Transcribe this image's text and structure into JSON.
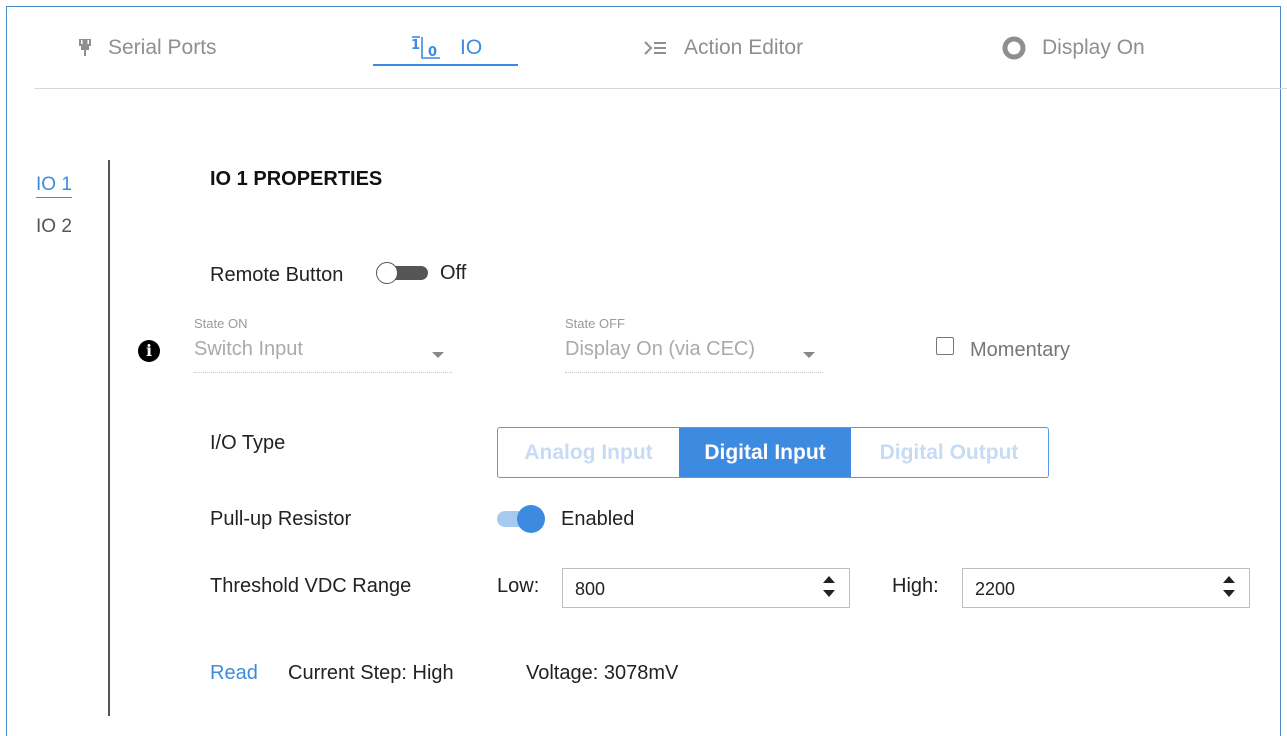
{
  "tabs": [
    {
      "label": "Serial Ports",
      "icon": "serial-port-icon",
      "active": false
    },
    {
      "label": "IO",
      "icon": "io-icon",
      "active": true
    },
    {
      "label": "Action Editor",
      "icon": "action-editor-icon",
      "active": false
    },
    {
      "label": "Display On",
      "icon": "display-on-icon",
      "active": false
    }
  ],
  "sidebar": {
    "items": [
      {
        "label": "IO 1",
        "active": true
      },
      {
        "label": "IO 2",
        "active": false
      }
    ]
  },
  "panel": {
    "title": "IO 1 PROPERTIES",
    "remote_button": {
      "label": "Remote Button",
      "state": "Off"
    },
    "state_on": {
      "caption": "State ON",
      "value": "Switch Input"
    },
    "state_off": {
      "caption": "State OFF",
      "value": "Display On (via CEC)"
    },
    "momentary": {
      "label": "Momentary",
      "checked": false
    },
    "io_type": {
      "label": "I/O Type",
      "options": [
        "Analog Input",
        "Digital Input",
        "Digital Output"
      ],
      "selected": "Digital Input"
    },
    "pullup": {
      "label": "Pull-up Resistor",
      "state": "Enabled"
    },
    "threshold": {
      "label": "Threshold VDC Range",
      "low_label": "Low:",
      "low_value": "800",
      "high_label": "High:",
      "high_value": "2200"
    },
    "status": {
      "read_link": "Read",
      "current_step": "Current Step: High",
      "voltage": "Voltage: 3078mV"
    }
  },
  "colors": {
    "accent": "#3d8be0",
    "muted": "#8f8f8f"
  }
}
